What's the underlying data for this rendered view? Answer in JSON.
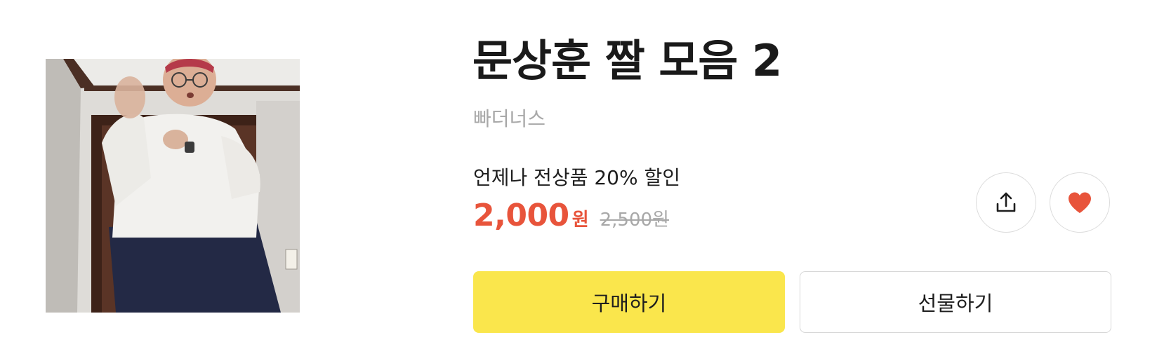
{
  "product": {
    "title": "문상훈 짤 모음 2",
    "author": "빠더너스",
    "promo_text": "언제나 전상품 20% 할인",
    "price": "2,000",
    "price_unit": "원",
    "original_price": "2,500원"
  },
  "actions": {
    "buy_label": "구매하기",
    "gift_label": "선물하기"
  },
  "icons": {
    "share": "share-upload-icon",
    "like": "heart-icon"
  },
  "colors": {
    "price": "#e8543b",
    "buy_button": "#fae64c",
    "heart": "#e8543b"
  }
}
